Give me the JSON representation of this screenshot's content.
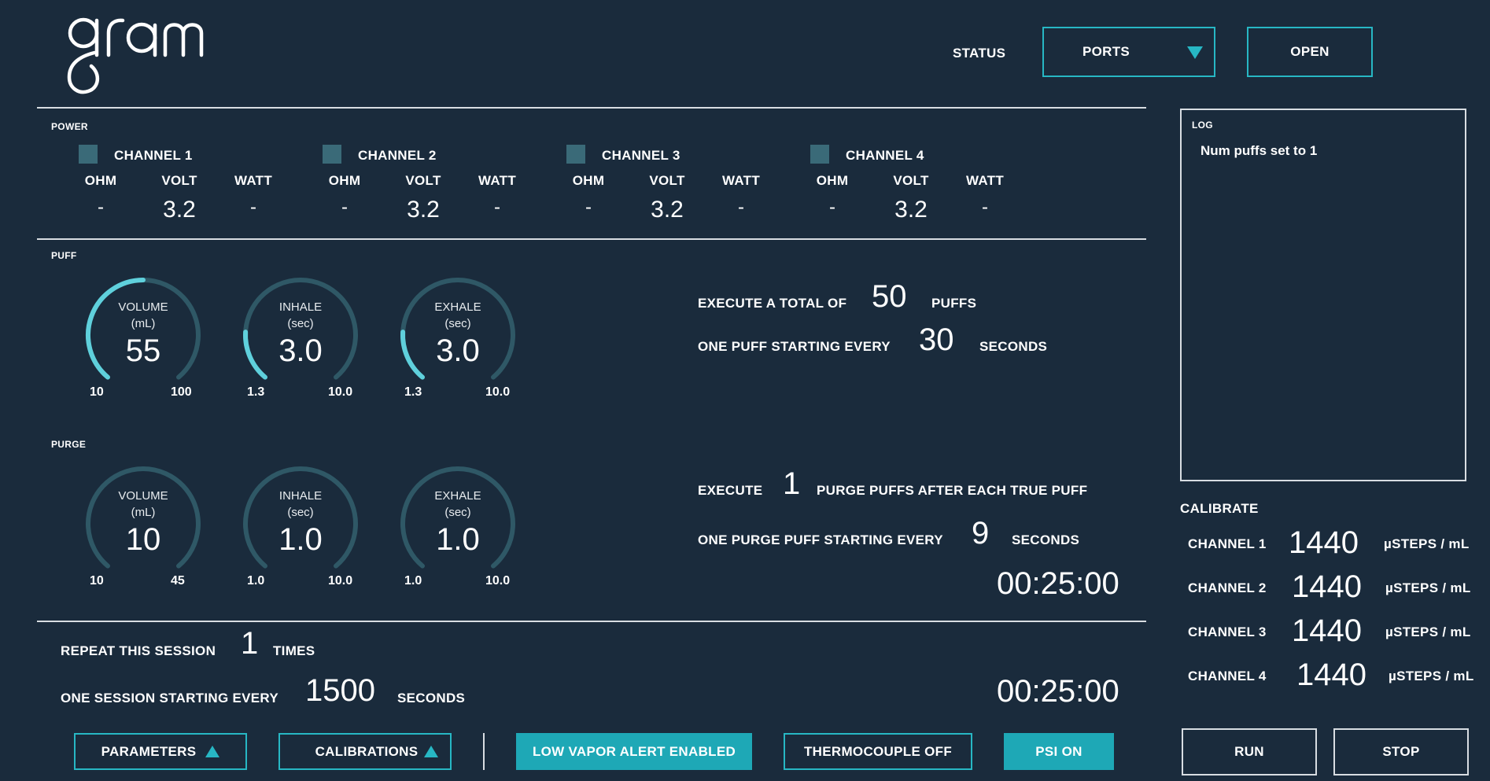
{
  "app": {
    "logo_text": "gram"
  },
  "header": {
    "status_label": "STATUS",
    "ports_label": "PORTS",
    "open_label": "OPEN"
  },
  "power": {
    "section_label": "POWER",
    "channels": [
      {
        "name": "CHANNEL 1",
        "ohm_label": "OHM",
        "volt_label": "VOLT",
        "watt_label": "WATT",
        "ohm": "-",
        "volt": "3.2",
        "watt": "-"
      },
      {
        "name": "CHANNEL 2",
        "ohm_label": "OHM",
        "volt_label": "VOLT",
        "watt_label": "WATT",
        "ohm": "-",
        "volt": "3.2",
        "watt": "-"
      },
      {
        "name": "CHANNEL 3",
        "ohm_label": "OHM",
        "volt_label": "VOLT",
        "watt_label": "WATT",
        "ohm": "-",
        "volt": "3.2",
        "watt": "-"
      },
      {
        "name": "CHANNEL 4",
        "ohm_label": "OHM",
        "volt_label": "VOLT",
        "watt_label": "WATT",
        "ohm": "-",
        "volt": "3.2",
        "watt": "-"
      }
    ]
  },
  "puff": {
    "section_label": "PUFF",
    "gauges": [
      {
        "title": "VOLUME",
        "unit": "(mL)",
        "value": "55",
        "min": "10",
        "max": "100",
        "fraction": 0.5
      },
      {
        "title": "INHALE",
        "unit": "(sec)",
        "value": "3.0",
        "min": "1.3",
        "max": "10.0",
        "fraction": 0.19
      },
      {
        "title": "EXHALE",
        "unit": "(sec)",
        "value": "3.0",
        "min": "1.3",
        "max": "10.0",
        "fraction": 0.19
      }
    ],
    "execute_prefix": "EXECUTE A TOTAL OF",
    "execute_value": "50",
    "execute_suffix": "PUFFS",
    "every_prefix": "ONE PUFF STARTING EVERY",
    "every_value": "30",
    "every_suffix": "SECONDS"
  },
  "purge": {
    "section_label": "PURGE",
    "gauges": [
      {
        "title": "VOLUME",
        "unit": "(mL)",
        "value": "10",
        "min": "10",
        "max": "45",
        "fraction": 0
      },
      {
        "title": "INHALE",
        "unit": "(sec)",
        "value": "1.0",
        "min": "1.0",
        "max": "10.0",
        "fraction": 0
      },
      {
        "title": "EXHALE",
        "unit": "(sec)",
        "value": "1.0",
        "min": "1.0",
        "max": "10.0",
        "fraction": 0
      }
    ],
    "execute_prefix": "EXECUTE",
    "execute_value": "1",
    "execute_suffix": "PURGE PUFFS AFTER EACH TRUE PUFF",
    "every_prefix": "ONE PURGE PUFF STARTING EVERY",
    "every_value": "9",
    "every_suffix": "SECONDS",
    "timer": "00:25:00"
  },
  "session": {
    "repeat_prefix": "REPEAT THIS SESSION",
    "repeat_value": "1",
    "repeat_suffix": "TIMES",
    "every_prefix": "ONE SESSION STARTING EVERY",
    "every_value": "1500",
    "every_suffix": "SECONDS",
    "timer": "00:25:00"
  },
  "log": {
    "label": "LOG",
    "lines": [
      "Num puffs set to 1"
    ]
  },
  "calibrate": {
    "label": "CALIBRATE",
    "rows": [
      {
        "name": "CHANNEL 1",
        "value": "1440",
        "unit": "µSTEPS / mL"
      },
      {
        "name": "CHANNEL 2",
        "value": "1440",
        "unit": "µSTEPS / mL"
      },
      {
        "name": "CHANNEL 3",
        "value": "1440",
        "unit": "µSTEPS / mL"
      },
      {
        "name": "CHANNEL 4",
        "value": "1440",
        "unit": "µSTEPS / mL"
      }
    ]
  },
  "footer": {
    "parameters": "PARAMETERS",
    "calibrations": "CALIBRATIONS",
    "low_vapor": "LOW VAPOR ALERT ENABLED",
    "thermocouple": "THERMOCOUPLE OFF",
    "psi": "PSI ON",
    "run": "RUN",
    "stop": "STOP"
  },
  "colors": {
    "background": "#1a2b3c",
    "accent": "#27b7c4",
    "accent_fill": "#1ea8b6",
    "track": "#2f5866",
    "arc_active": "#5fd0dc",
    "checkbox": "#3a6a78"
  }
}
